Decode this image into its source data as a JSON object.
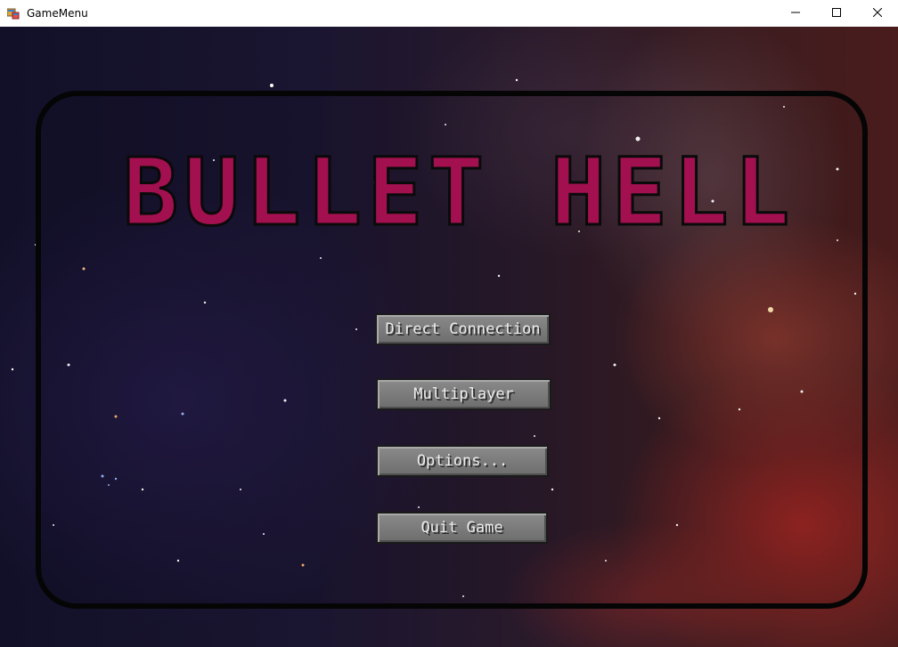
{
  "window": {
    "title": "GameMenu",
    "icon": "app-window-icon",
    "controls": {
      "minimize_icon": "minimize-icon",
      "maximize_icon": "maximize-icon",
      "close_icon": "close-icon"
    }
  },
  "game": {
    "logo_text": "BULLET HELL",
    "logo_color": "#a3104f"
  },
  "menu": {
    "direct_connection": "Direct Connection",
    "multiplayer": "Multiplayer",
    "options": "Options...",
    "quit": "Quit Game"
  },
  "colors": {
    "button_face": "#7b7b7b",
    "button_text": "#ececec",
    "panel_border": "#050505"
  }
}
